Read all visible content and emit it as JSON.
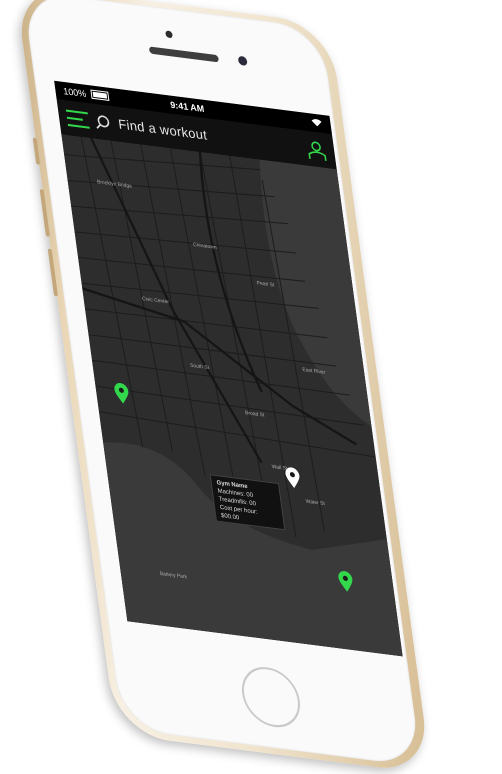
{
  "status_bar": {
    "battery": "100%",
    "time": "9:41 AM"
  },
  "navbar": {
    "title": "Find a workout"
  },
  "map": {
    "popup": {
      "title": "Gym Name",
      "line1": "Machines: 00",
      "line2": "Treadmills: 00",
      "line3": "Cost per hour:",
      "line4": "$00.00"
    },
    "labels": [
      "Brooklyn Bridge",
      "Chinatown",
      "Civic Center",
      "East River",
      "Battery Park",
      "Wall St",
      "Broad St",
      "Water St",
      "South St",
      "Pearl St"
    ],
    "pins": [
      {
        "color": "#32d74b",
        "name": "gym-pin-west"
      },
      {
        "color": "#ffffff",
        "name": "gym-pin-selected"
      },
      {
        "color": "#32d74b",
        "name": "gym-pin-south"
      }
    ]
  },
  "colors": {
    "accent": "#32d74b",
    "map_background": "#2e2e2e",
    "navbar": "#111111",
    "phone_body": "#ead7b7"
  }
}
